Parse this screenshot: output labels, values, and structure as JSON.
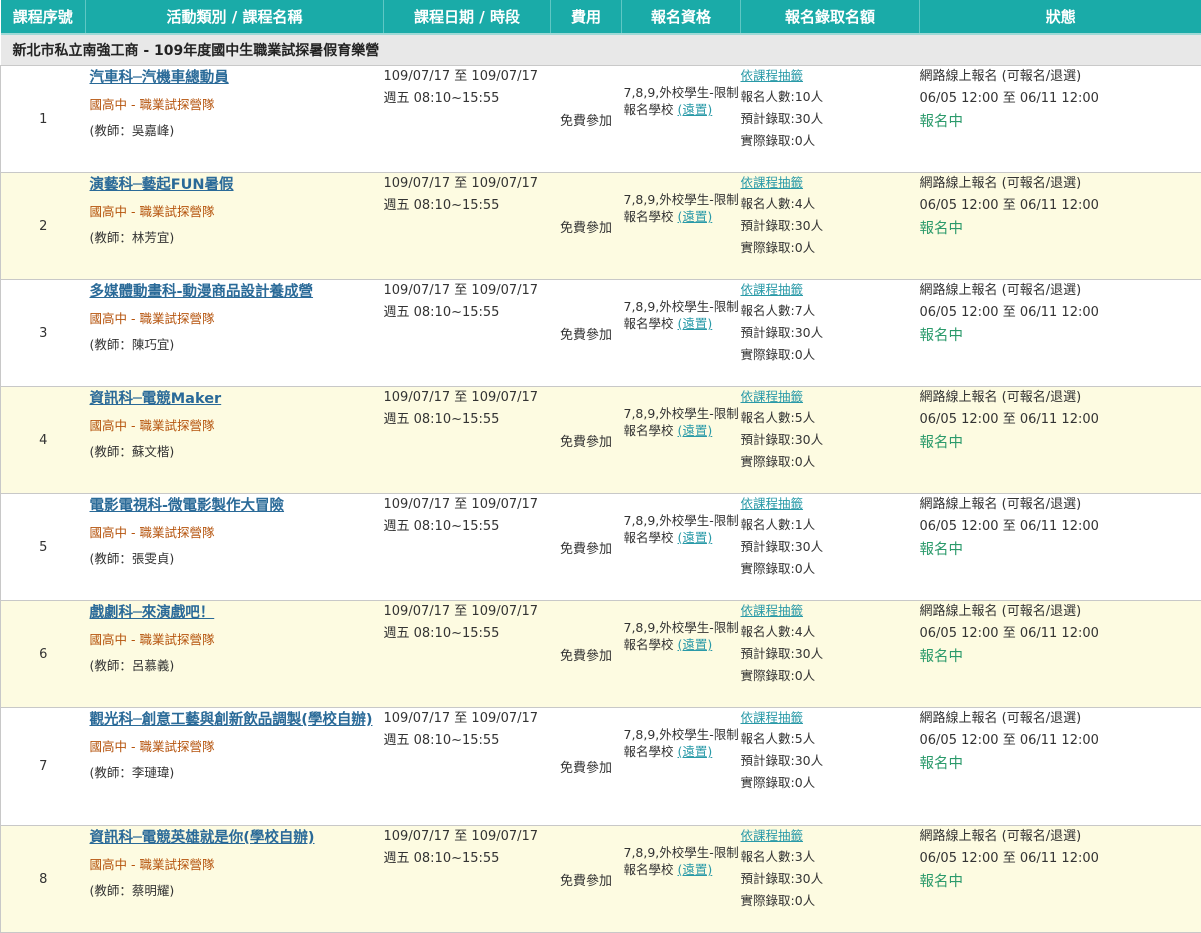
{
  "header": {
    "columns": [
      "課程序號",
      "活動類別 / 課程名稱",
      "課程日期 / 時段",
      "費用",
      "報名資格",
      "報名錄取名額",
      "狀態"
    ]
  },
  "school_title": "新北市私立南強工商 - 109年度國中生職業試探暑假育樂營",
  "colors": {
    "header_bg": "#1aaba8",
    "row_even_bg": "#fdfbe1",
    "link": "#2a6a98",
    "category": "#b5530c",
    "status_green": "#2b9a6b"
  },
  "courses": [
    {
      "seq": "1",
      "name": "汽車科─汽機車總動員",
      "category": "國高中 - 職業試探營隊",
      "teacher": "(教師：吳嘉峰)",
      "date_range": "109/07/17 至 109/07/17",
      "time": "週五 08:10~15:55",
      "fee": "免費參加",
      "qual_text": "7,8,9,外校學生-限制報名學校",
      "qual_link": "(遠置)",
      "quota_method": "依課程抽籤",
      "applicants": "報名人數:10人",
      "expected": "預計錄取:30人",
      "actual": "實際錄取:0人",
      "reg_mode": "網路線上報名 (可報名/退選)",
      "reg_period": "06/05 12:00 至 06/11 12:00",
      "state": "報名中"
    },
    {
      "seq": "2",
      "name": "演藝科─藝起FUN暑假",
      "category": "國高中 - 職業試探營隊",
      "teacher": "(教師：林芳宜)",
      "date_range": "109/07/17 至 109/07/17",
      "time": "週五 08:10~15:55",
      "fee": "免費參加",
      "qual_text": "7,8,9,外校學生-限制報名學校",
      "qual_link": "(遠置)",
      "quota_method": "依課程抽籤",
      "applicants": "報名人數:4人",
      "expected": "預計錄取:30人",
      "actual": "實際錄取:0人",
      "reg_mode": "網路線上報名 (可報名/退選)",
      "reg_period": "06/05 12:00 至 06/11 12:00",
      "state": "報名中"
    },
    {
      "seq": "3",
      "name": "多媒體動畫科-動漫商品設計養成營",
      "category": "國高中 - 職業試探營隊",
      "teacher": "(教師：陳巧宜)",
      "date_range": "109/07/17 至 109/07/17",
      "time": "週五 08:10~15:55",
      "fee": "免費參加",
      "qual_text": "7,8,9,外校學生-限制報名學校",
      "qual_link": "(遠置)",
      "quota_method": "依課程抽籤",
      "applicants": "報名人數:7人",
      "expected": "預計錄取:30人",
      "actual": "實際錄取:0人",
      "reg_mode": "網路線上報名 (可報名/退選)",
      "reg_period": "06/05 12:00 至 06/11 12:00",
      "state": "報名中"
    },
    {
      "seq": "4",
      "name": "資訊科─電競Maker",
      "category": "國高中 - 職業試探營隊",
      "teacher": "(教師：蘇文楷)",
      "date_range": "109/07/17 至 109/07/17",
      "time": "週五 08:10~15:55",
      "fee": "免費參加",
      "qual_text": "7,8,9,外校學生-限制報名學校",
      "qual_link": "(遠置)",
      "quota_method": "依課程抽籤",
      "applicants": "報名人數:5人",
      "expected": "預計錄取:30人",
      "actual": "實際錄取:0人",
      "reg_mode": "網路線上報名 (可報名/退選)",
      "reg_period": "06/05 12:00 至 06/11 12:00",
      "state": "報名中"
    },
    {
      "seq": "5",
      "name": "電影電視科-微電影製作大冒險",
      "category": "國高中 - 職業試探營隊",
      "teacher": "(教師：張雯貞)",
      "date_range": "109/07/17 至 109/07/17",
      "time": "週五 08:10~15:55",
      "fee": "免費參加",
      "qual_text": "7,8,9,外校學生-限制報名學校",
      "qual_link": "(遠置)",
      "quota_method": "依課程抽籤",
      "applicants": "報名人數:1人",
      "expected": "預計錄取:30人",
      "actual": "實際錄取:0人",
      "reg_mode": "網路線上報名 (可報名/退選)",
      "reg_period": "06/05 12:00 至 06/11 12:00",
      "state": "報名中"
    },
    {
      "seq": "6",
      "name": "戲劇科─來演戲吧！",
      "category": "國高中 - 職業試探營隊",
      "teacher": "(教師：呂慕義)",
      "date_range": "109/07/17 至 109/07/17",
      "time": "週五 08:10~15:55",
      "fee": "免費參加",
      "qual_text": "7,8,9,外校學生-限制報名學校",
      "qual_link": "(遠置)",
      "quota_method": "依課程抽籤",
      "applicants": "報名人數:4人",
      "expected": "預計錄取:30人",
      "actual": "實際錄取:0人",
      "reg_mode": "網路線上報名 (可報名/退選)",
      "reg_period": "06/05 12:00 至 06/11 12:00",
      "state": "報名中"
    },
    {
      "seq": "7",
      "name": "觀光科─創意工藝與創新飲品調製(學校自辦)",
      "category": "國高中 - 職業試探營隊",
      "teacher": "(教師：李璉瑋)",
      "date_range": "109/07/17 至 109/07/17",
      "time": "週五 08:10~15:55",
      "fee": "免費參加",
      "qual_text": "7,8,9,外校學生-限制報名學校",
      "qual_link": "(遠置)",
      "quota_method": "依課程抽籤",
      "applicants": "報名人數:5人",
      "expected": "預計錄取:30人",
      "actual": "實際錄取:0人",
      "reg_mode": "網路線上報名 (可報名/退選)",
      "reg_period": "06/05 12:00 至 06/11 12:00",
      "state": "報名中"
    },
    {
      "seq": "8",
      "name": "資訊科─電競英雄就是你(學校自辦)",
      "category": "國高中 - 職業試探營隊",
      "teacher": "(教師：蔡明耀)",
      "date_range": "109/07/17 至 109/07/17",
      "time": "週五 08:10~15:55",
      "fee": "免費參加",
      "qual_text": "7,8,9,外校學生-限制報名學校",
      "qual_link": "(遠置)",
      "quota_method": "依課程抽籤",
      "applicants": "報名人數:3人",
      "expected": "預計錄取:30人",
      "actual": "實際錄取:0人",
      "reg_mode": "網路線上報名 (可報名/退選)",
      "reg_period": "06/05 12:00 至 06/11 12:00",
      "state": "報名中"
    }
  ]
}
